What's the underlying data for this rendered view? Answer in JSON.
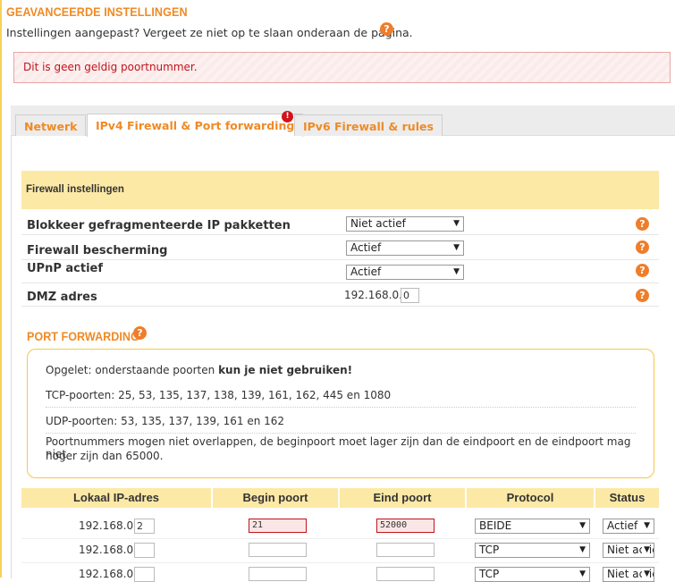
{
  "page": {
    "title": "GEAVANCEERDE INSTELLINGEN",
    "subtitle": "Instellingen aangepast? Vergeet ze niet op te slaan onderaan de pagina.",
    "help_glyph": "?"
  },
  "error": {
    "message": "Dit is geen geldig poortnummer."
  },
  "tabs": [
    {
      "label": "Netwerk"
    },
    {
      "label": "IPv4 Firewall & Port forwarding"
    },
    {
      "label": "IPv6 Firewall & rules"
    }
  ],
  "tab_warning_glyph": "!",
  "firewall": {
    "header": "Firewall instellingen",
    "rows": [
      {
        "label": "Blokkeer gefragmenteerde IP pakketten",
        "value": "Niet actief"
      },
      {
        "label": "Firewall bescherming",
        "value": "Actief"
      },
      {
        "label": "UPnP actief",
        "value": "Actief"
      },
      {
        "label": "DMZ adres",
        "prefix": "192.168.0.",
        "value": "0"
      }
    ]
  },
  "port_forwarding": {
    "title": "PORT FORWARDING",
    "notice": {
      "intro": "Opgelet: onderstaande poorten ",
      "intro_bold": "kun je niet gebruiken!",
      "tcp": "TCP-poorten: 25, 53, 135, 137, 138, 139, 161, 162, 445 en 1080",
      "udp": "UDP-poorten: 53, 135, 137, 139, 161 en 162",
      "rule_line1": "Poortnummers mogen niet overlappen, de beginpoort moet lager zijn dan de eindpoort en de eindpoort mag niet",
      "rule_line2": "hoger zijn dan 65000."
    },
    "columns": [
      "Lokaal IP-adres",
      "Begin poort",
      "Eind poort",
      "Protocol",
      "Status"
    ],
    "rows": [
      {
        "ip_prefix": "192.168.0.",
        "ip_suffix": "2",
        "begin": "21",
        "end": "52000",
        "protocol": "BEIDE",
        "status": "Actief"
      },
      {
        "ip_prefix": "192.168.0.",
        "ip_suffix": "",
        "begin": "",
        "end": "",
        "protocol": "TCP",
        "status": "Niet actief"
      },
      {
        "ip_prefix": "192.168.0.",
        "ip_suffix": "",
        "begin": "",
        "end": "",
        "protocol": "TCP",
        "status": "Niet actief"
      }
    ]
  },
  "colors": {
    "accent": "#f08a24",
    "error_text": "#c0141c",
    "header_bg": "#fde9a6"
  }
}
